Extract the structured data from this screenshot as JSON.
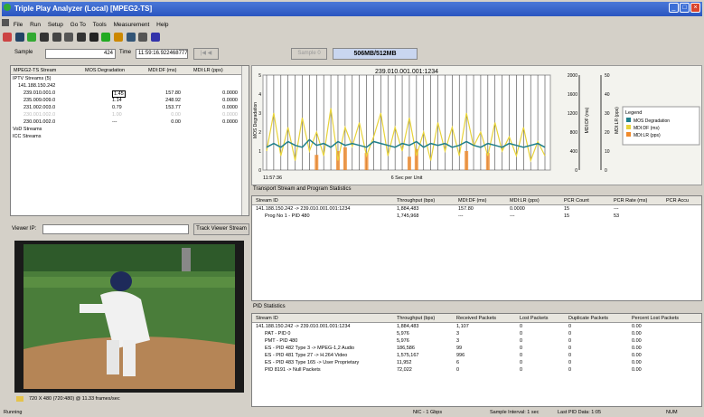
{
  "window": {
    "title": "Triple Play Analyzer (Local) [MPEG2-TS]"
  },
  "menu": [
    "File",
    "Run",
    "Setup",
    "Go To",
    "Tools",
    "Measurement",
    "Help"
  ],
  "controls": {
    "sample_label": "Sample",
    "sample_value": "424",
    "time_label": "Time",
    "time_value": "11:59:16.922468777",
    "sample_btn": "Sample 0",
    "memory": "506MB/512MB"
  },
  "stream_table": {
    "headers": [
      "MPEG2-TS Stream",
      "MOS Degradation",
      "MDI:DF (ms)",
      "MDI:LR (pps)"
    ],
    "rows": [
      {
        "name": "IPTV Streams (5)",
        "mos": "",
        "df": "",
        "lr": ""
      },
      {
        "name": "141.188.150.242",
        "mos": "",
        "df": "",
        "lr": ""
      },
      {
        "name": "239.010.001.0",
        "mos": "1.45",
        "df": "157.80",
        "lr": "0.0000"
      },
      {
        "name": "235.009.009.0",
        "mos": "1.14",
        "df": "248.92",
        "lr": "0.0000"
      },
      {
        "name": "231.002.003.0",
        "mos": "0.79",
        "df": "153.77",
        "lr": "0.0000"
      },
      {
        "name": "230.001.002.0",
        "mos": "1.00",
        "df": "0.00",
        "lr": "0.0000"
      },
      {
        "name": "230.001.002.0",
        "mos": "---",
        "df": "0.00",
        "lr": "0.0000"
      },
      {
        "name": "VoD Streams",
        "mos": "",
        "df": "",
        "lr": ""
      },
      {
        "name": "ICC Streams",
        "mos": "",
        "df": "",
        "lr": ""
      }
    ]
  },
  "viewer": {
    "label": "Viewer IP:",
    "button": "Track Viewer Stream",
    "status": "720 X 480 (720:480) @ 11.33 frames/sec"
  },
  "chart_data": {
    "type": "line",
    "title": "239.010.001.001:1234",
    "xlabel": "6 Sec per Unit",
    "x_start": "11:57:36",
    "ylabel_left": "MOS Degradation",
    "ylabel_mid": "MDI:DF (ms)",
    "ylabel_right": "MDI:LR (pps)",
    "y_left_ticks": [
      "0",
      "1",
      "2",
      "3",
      "4",
      "5"
    ],
    "y_mid_ticks": [
      "0",
      "400",
      "800",
      "1200",
      "1600",
      "2000"
    ],
    "y_right_ticks": [
      "0",
      "10",
      "20",
      "30",
      "40",
      "50"
    ],
    "legend_title": "Legend",
    "series": [
      {
        "name": "MOS Degradation",
        "color": "#1f7f8a",
        "values": [
          1.2,
          1.4,
          1.2,
          1.5,
          1.3,
          1.2,
          1.6,
          1.3,
          1.4,
          1.2,
          1.5,
          1.3,
          1.4,
          1.3,
          1.2,
          1.5,
          1.4,
          1.3,
          1.2,
          1.4,
          1.3,
          1.5,
          1.2,
          1.4,
          1.3,
          1.4,
          1.2,
          1.3,
          1.5,
          1.3,
          1.2,
          1.4,
          1.3,
          1.2,
          1.4,
          1.3,
          1.2,
          1.3,
          1.4,
          1.2
        ]
      },
      {
        "name": "MDI:DF (ms)",
        "color": "#e8d33a",
        "values": [
          400,
          1200,
          300,
          900,
          200,
          1100,
          400,
          800,
          300,
          1300,
          200,
          900,
          500,
          1000,
          300,
          700,
          1200,
          300,
          900,
          400,
          1100,
          300,
          800,
          200,
          1000,
          400,
          900,
          300,
          1200,
          500,
          800,
          300,
          1000,
          400,
          700,
          300,
          900,
          200,
          600,
          300
        ]
      },
      {
        "name": "MDI:LR (pps)",
        "color": "#f08a2a",
        "values": [
          0,
          0,
          0,
          0,
          0,
          0,
          0,
          8,
          0,
          0,
          10,
          12,
          0,
          0,
          9,
          0,
          0,
          0,
          0,
          0,
          7,
          11,
          0,
          0,
          0,
          0,
          0,
          0,
          10,
          0,
          0,
          9,
          0,
          0,
          0,
          0,
          0,
          0,
          0,
          0
        ]
      }
    ]
  },
  "transport": {
    "title": "Transport Stream and Program Statistics",
    "headers": [
      "Stream ID",
      "Throughput (bps)",
      "MDI:DF (ms)",
      "MDI:LR (pps)",
      "PCR Count",
      "PCR Rate (ms)",
      "PCR Accu"
    ],
    "rows": [
      [
        "141.188.150.242 -> 239.010.001.001:1234",
        "1,884,483",
        "157.80",
        "0.0000",
        "15",
        "---",
        ""
      ],
      [
        "Prog No 1 - PID 480",
        "1,745,968",
        "---",
        "---",
        "15",
        "53",
        ""
      ]
    ]
  },
  "pid": {
    "title": "PID Statistics",
    "headers": [
      "Stream ID",
      "Throughput (bps)",
      "Received Packets",
      "Lost Packets",
      "Duplicate Packets",
      "Percent Lost Packets"
    ],
    "rows": [
      [
        "141.188.150.242 -> 239.010.001.001:1234",
        "1,884,483",
        "1,107",
        "0",
        "0",
        "0.00"
      ],
      [
        "PAT - PID 0",
        "5,976",
        "3",
        "0",
        "0",
        "0.00"
      ],
      [
        "PMT - PID 480",
        "5,976",
        "3",
        "0",
        "0",
        "0.00"
      ],
      [
        "ES - PID 482 Type 3 -> MPEG-1,2 Audio",
        "186,586",
        "99",
        "0",
        "0",
        "0.00"
      ],
      [
        "ES - PID 481 Type 27 -> H.264 Video",
        "1,575,167",
        "996",
        "0",
        "0",
        "0.00"
      ],
      [
        "ES - PID 483 Type 165 -> User Proprietary",
        "11,952",
        "6",
        "0",
        "0",
        "0.00"
      ],
      [
        "PID 8191 -> Null Packets",
        "72,022",
        "0",
        "0",
        "0",
        "0.00"
      ]
    ]
  },
  "statusbar": {
    "left": "Running",
    "nic": "NIC - 1 Gbps",
    "interval": "Sample Interval: 1 sec",
    "lastpid": "Last PID Data: 1:05",
    "num": "NUM"
  }
}
